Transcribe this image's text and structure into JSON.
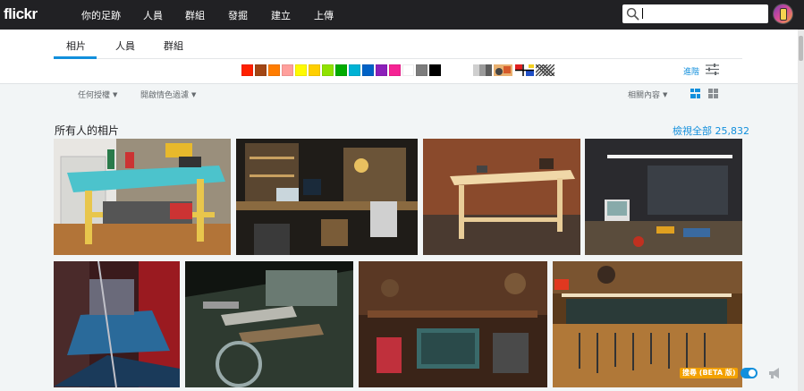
{
  "app": {
    "logo": "flickr"
  },
  "topnav": {
    "items": [
      "你的足跡",
      "人員",
      "群組",
      "發掘",
      "建立",
      "上傳"
    ],
    "search_value": ""
  },
  "tabs": [
    {
      "label": "相片",
      "active": true
    },
    {
      "label": "人員",
      "active": false
    },
    {
      "label": "群組",
      "active": false
    }
  ],
  "colors": [
    "#ff2000",
    "#a24615",
    "#ff7c00",
    "#ff9f9c",
    "#fffa00",
    "#ffcf00",
    "#90e200",
    "#00ab00",
    "#00b2d4",
    "#0062c6",
    "#8c20ba",
    "#f52394",
    "#ffffff",
    "#7c7c7c",
    "#000000"
  ],
  "advanced": {
    "label": "進階"
  },
  "filters": {
    "license": "任何授權",
    "safesearch": "開啟情色過濾",
    "sort": "相關內容"
  },
  "section": {
    "title": "所有人的相片",
    "view_all": "檢視全部 25,832"
  },
  "photos": [
    {
      "name": "photo-turquoise-workbench"
    },
    {
      "name": "photo-cluttered-electronics-desk"
    },
    {
      "name": "photo-wooden-workbench"
    },
    {
      "name": "photo-electronics-workstation"
    },
    {
      "name": "photo-abstract-red-blue"
    },
    {
      "name": "photo-tools-on-bench"
    },
    {
      "name": "photo-hdr-workshop"
    },
    {
      "name": "photo-pegboard-tools"
    }
  ],
  "beta": {
    "label": "搜尋 (BETA 版)",
    "enabled": true
  },
  "theme": {
    "accent": "#128fdc",
    "nav_bg": "#212124"
  }
}
